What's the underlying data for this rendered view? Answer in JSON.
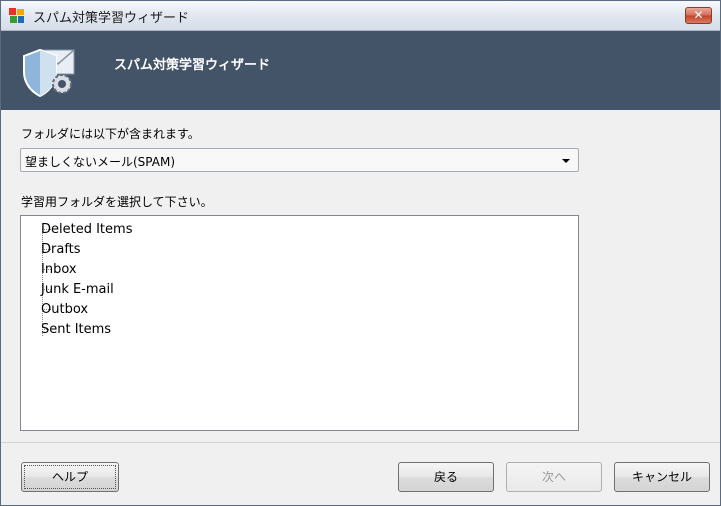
{
  "window": {
    "title": "スパム対策学習ウィザード",
    "close_label": "✕"
  },
  "banner": {
    "title": "スパム対策学習ウィザード"
  },
  "form": {
    "folder_contains_label": "フォルダには以下が含まれます。",
    "folder_type_selected": "望ましくないメール(SPAM)",
    "select_folder_label": "学習用フォルダを選択して下さい。",
    "folders": [
      "Deleted Items",
      "Drafts",
      "Inbox",
      "Junk E-mail",
      "Outbox",
      "Sent Items"
    ]
  },
  "buttons": {
    "help": "ヘルプ",
    "back": "戻る",
    "next": "次へ",
    "cancel": "キャンセル"
  },
  "colors": {
    "banner_bg": "#435468",
    "close_button": "#c4402a"
  },
  "icons": {
    "app": "avg-logo-icon",
    "banner": "shield-mail-gear-icon",
    "dropdown": "chevron-down-icon"
  }
}
